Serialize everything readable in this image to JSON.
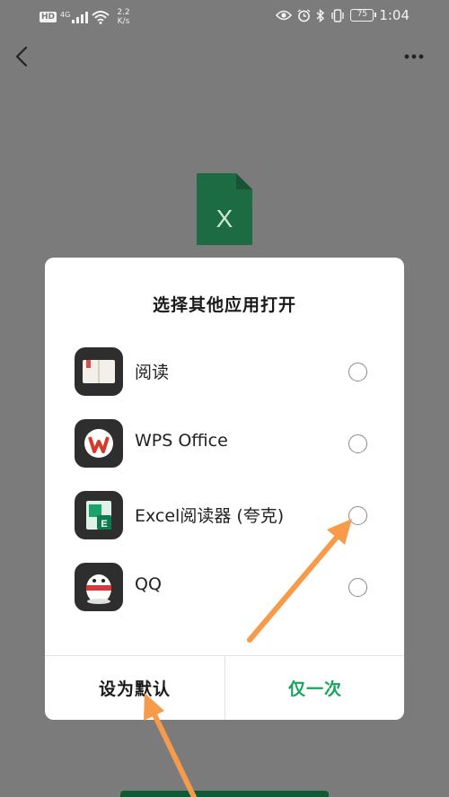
{
  "status_bar": {
    "hd": "HD",
    "signal_label": "4G",
    "speed_value": "2.2",
    "speed_unit": "K/s",
    "battery": "75",
    "time": "1:04"
  },
  "file": {
    "letter": "X",
    "color": "#1d6b43"
  },
  "dialog": {
    "title": "选择其他应用打开",
    "apps": [
      {
        "label": "阅读",
        "icon": "book-icon"
      },
      {
        "label": "WPS Office",
        "icon": "wps-icon"
      },
      {
        "label": "Excel阅读器 (夸克)",
        "icon": "excel-reader-icon"
      },
      {
        "label": "QQ",
        "icon": "qq-icon"
      }
    ],
    "set_default_label": "设为默认",
    "just_once_label": "仅一次"
  },
  "colors": {
    "accent_green": "#17a55b",
    "overlay": "#7b7b7b",
    "annotation_arrow": "#f79a4a"
  }
}
